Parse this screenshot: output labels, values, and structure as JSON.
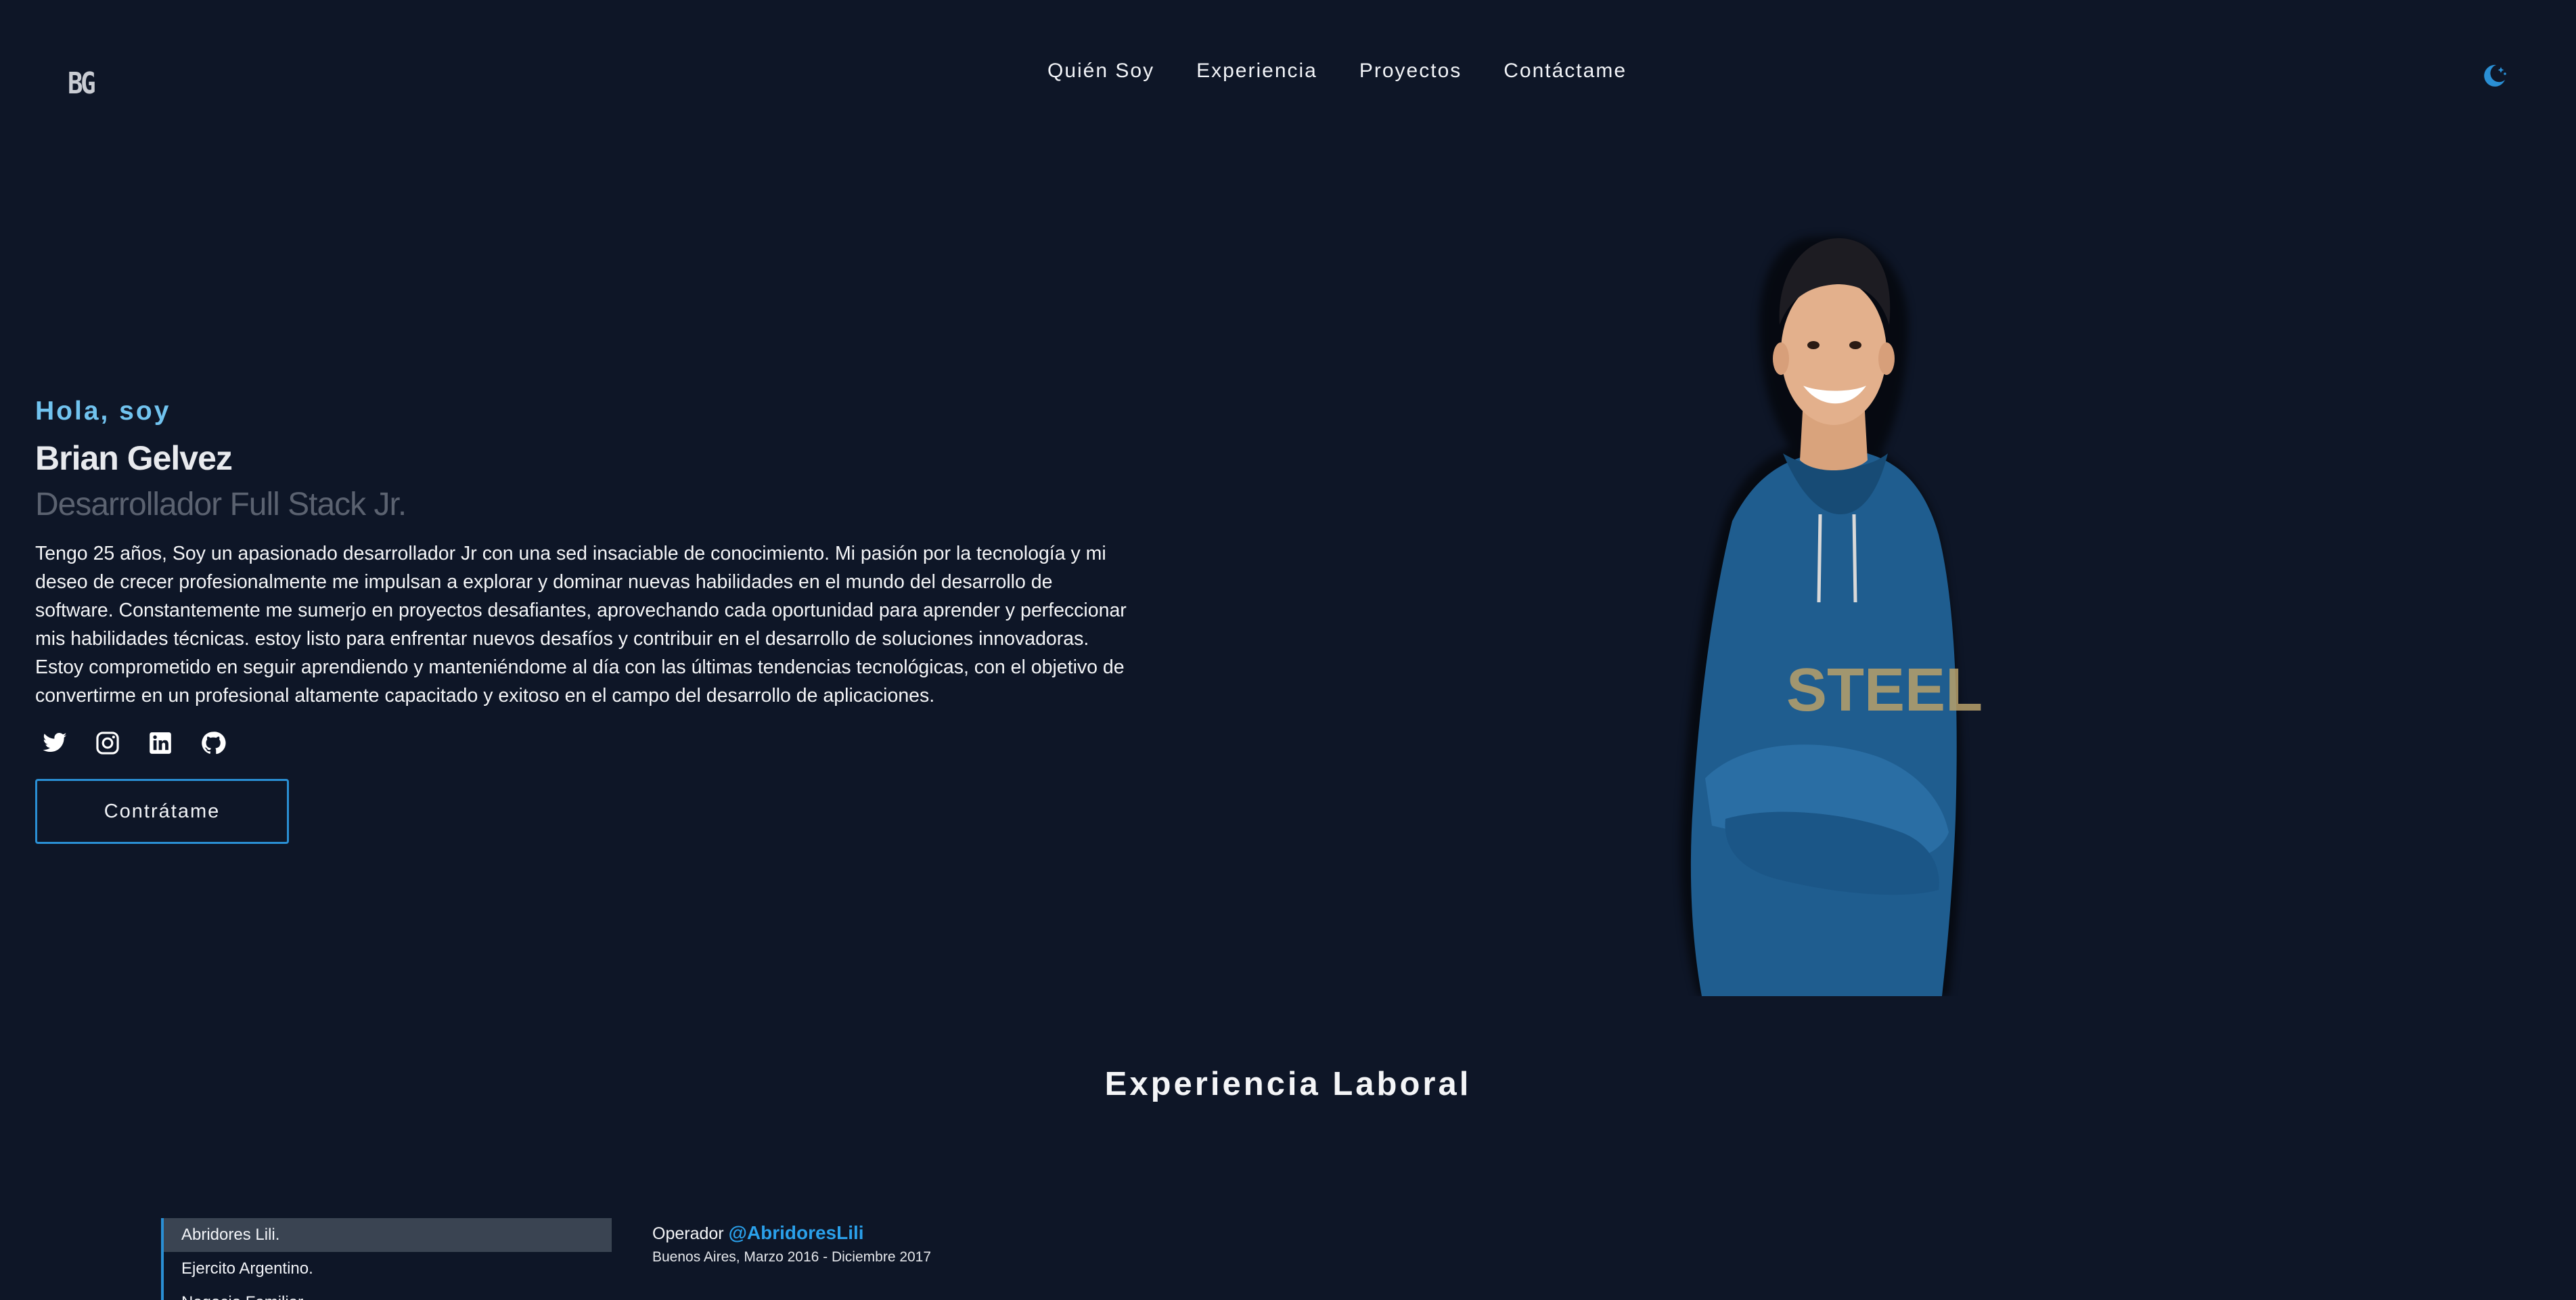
{
  "header": {
    "logo": "BG",
    "nav": [
      "Quién Soy",
      "Experiencia",
      "Proyectos",
      "Contáctame"
    ],
    "theme_icon": "moon-stars-icon",
    "accent_color": "#2a8fd4"
  },
  "hero": {
    "greeting": "Hola, soy",
    "name": "Brian Gelvez",
    "role": "Desarrollador Full Stack Jr.",
    "bio": "Tengo 25 años, Soy un apasionado desarrollador Jr con una sed insaciable de conocimiento. Mi pasión por la tecnología y mi deseo de crecer profesionalmente me impulsan a explorar y dominar nuevas habilidades en el mundo del desarrollo de software. Constantemente me sumerjo en proyectos desafiantes, aprovechando cada oportunidad para aprender y perfeccionar mis habilidades técnicas. estoy listo para enfrentar nuevos desafíos y contribuir en el desarrollo de soluciones innovadoras. Estoy comprometido en seguir aprendiendo y manteniéndome al día con las últimas tendencias tecnológicas, con el objetivo de convertirme en un profesional altamente capacitado y exitoso en el campo del desarrollo de aplicaciones.",
    "socials": [
      "twitter-icon",
      "instagram-icon",
      "linkedin-icon",
      "github-icon"
    ],
    "cta_label": "Contrátame"
  },
  "experience": {
    "title": "Experiencia Laboral",
    "tabs": [
      "Abridores Lili.",
      "Ejercito Argentino.",
      "Negocio Familiar."
    ],
    "active_tab": 0,
    "job": {
      "role": "Operador",
      "company": "@AbridoresLili",
      "meta": "Buenos Aires, Marzo 2016 - Diciembre 2017"
    }
  }
}
